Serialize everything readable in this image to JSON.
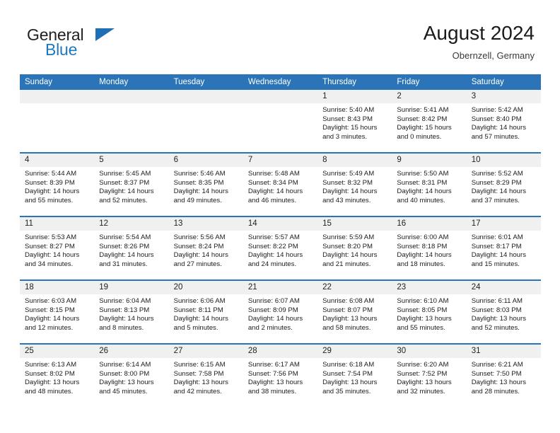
{
  "brand": {
    "name_top": "General",
    "name_bottom": "Blue",
    "accent_color": "#1f78bd",
    "dark_color": "#231f20"
  },
  "header": {
    "title": "August 2024",
    "subtitle": "Obernzell, Germany"
  },
  "theme": {
    "header_blue": "#2b74b8",
    "daynum_gray": "#f0f0f0",
    "text": "#1c1c1c"
  },
  "weekday_headers": [
    "Sunday",
    "Monday",
    "Tuesday",
    "Wednesday",
    "Thursday",
    "Friday",
    "Saturday"
  ],
  "labels": {
    "sunrise": "Sunrise:",
    "sunset": "Sunset:",
    "daylight": "Daylight:"
  },
  "weeks": [
    [
      {
        "day": "",
        "sunrise": "",
        "sunset": "",
        "daylight": ""
      },
      {
        "day": "",
        "sunrise": "",
        "sunset": "",
        "daylight": ""
      },
      {
        "day": "",
        "sunrise": "",
        "sunset": "",
        "daylight": ""
      },
      {
        "day": "",
        "sunrise": "",
        "sunset": "",
        "daylight": ""
      },
      {
        "day": "1",
        "sunrise": "Sunrise: 5:40 AM",
        "sunset": "Sunset: 8:43 PM",
        "daylight": "Daylight: 15 hours and 3 minutes."
      },
      {
        "day": "2",
        "sunrise": "Sunrise: 5:41 AM",
        "sunset": "Sunset: 8:42 PM",
        "daylight": "Daylight: 15 hours and 0 minutes."
      },
      {
        "day": "3",
        "sunrise": "Sunrise: 5:42 AM",
        "sunset": "Sunset: 8:40 PM",
        "daylight": "Daylight: 14 hours and 57 minutes."
      }
    ],
    [
      {
        "day": "4",
        "sunrise": "Sunrise: 5:44 AM",
        "sunset": "Sunset: 8:39 PM",
        "daylight": "Daylight: 14 hours and 55 minutes."
      },
      {
        "day": "5",
        "sunrise": "Sunrise: 5:45 AM",
        "sunset": "Sunset: 8:37 PM",
        "daylight": "Daylight: 14 hours and 52 minutes."
      },
      {
        "day": "6",
        "sunrise": "Sunrise: 5:46 AM",
        "sunset": "Sunset: 8:35 PM",
        "daylight": "Daylight: 14 hours and 49 minutes."
      },
      {
        "day": "7",
        "sunrise": "Sunrise: 5:48 AM",
        "sunset": "Sunset: 8:34 PM",
        "daylight": "Daylight: 14 hours and 46 minutes."
      },
      {
        "day": "8",
        "sunrise": "Sunrise: 5:49 AM",
        "sunset": "Sunset: 8:32 PM",
        "daylight": "Daylight: 14 hours and 43 minutes."
      },
      {
        "day": "9",
        "sunrise": "Sunrise: 5:50 AM",
        "sunset": "Sunset: 8:31 PM",
        "daylight": "Daylight: 14 hours and 40 minutes."
      },
      {
        "day": "10",
        "sunrise": "Sunrise: 5:52 AM",
        "sunset": "Sunset: 8:29 PM",
        "daylight": "Daylight: 14 hours and 37 minutes."
      }
    ],
    [
      {
        "day": "11",
        "sunrise": "Sunrise: 5:53 AM",
        "sunset": "Sunset: 8:27 PM",
        "daylight": "Daylight: 14 hours and 34 minutes."
      },
      {
        "day": "12",
        "sunrise": "Sunrise: 5:54 AM",
        "sunset": "Sunset: 8:26 PM",
        "daylight": "Daylight: 14 hours and 31 minutes."
      },
      {
        "day": "13",
        "sunrise": "Sunrise: 5:56 AM",
        "sunset": "Sunset: 8:24 PM",
        "daylight": "Daylight: 14 hours and 27 minutes."
      },
      {
        "day": "14",
        "sunrise": "Sunrise: 5:57 AM",
        "sunset": "Sunset: 8:22 PM",
        "daylight": "Daylight: 14 hours and 24 minutes."
      },
      {
        "day": "15",
        "sunrise": "Sunrise: 5:59 AM",
        "sunset": "Sunset: 8:20 PM",
        "daylight": "Daylight: 14 hours and 21 minutes."
      },
      {
        "day": "16",
        "sunrise": "Sunrise: 6:00 AM",
        "sunset": "Sunset: 8:18 PM",
        "daylight": "Daylight: 14 hours and 18 minutes."
      },
      {
        "day": "17",
        "sunrise": "Sunrise: 6:01 AM",
        "sunset": "Sunset: 8:17 PM",
        "daylight": "Daylight: 14 hours and 15 minutes."
      }
    ],
    [
      {
        "day": "18",
        "sunrise": "Sunrise: 6:03 AM",
        "sunset": "Sunset: 8:15 PM",
        "daylight": "Daylight: 14 hours and 12 minutes."
      },
      {
        "day": "19",
        "sunrise": "Sunrise: 6:04 AM",
        "sunset": "Sunset: 8:13 PM",
        "daylight": "Daylight: 14 hours and 8 minutes."
      },
      {
        "day": "20",
        "sunrise": "Sunrise: 6:06 AM",
        "sunset": "Sunset: 8:11 PM",
        "daylight": "Daylight: 14 hours and 5 minutes."
      },
      {
        "day": "21",
        "sunrise": "Sunrise: 6:07 AM",
        "sunset": "Sunset: 8:09 PM",
        "daylight": "Daylight: 14 hours and 2 minutes."
      },
      {
        "day": "22",
        "sunrise": "Sunrise: 6:08 AM",
        "sunset": "Sunset: 8:07 PM",
        "daylight": "Daylight: 13 hours and 58 minutes."
      },
      {
        "day": "23",
        "sunrise": "Sunrise: 6:10 AM",
        "sunset": "Sunset: 8:05 PM",
        "daylight": "Daylight: 13 hours and 55 minutes."
      },
      {
        "day": "24",
        "sunrise": "Sunrise: 6:11 AM",
        "sunset": "Sunset: 8:03 PM",
        "daylight": "Daylight: 13 hours and 52 minutes."
      }
    ],
    [
      {
        "day": "25",
        "sunrise": "Sunrise: 6:13 AM",
        "sunset": "Sunset: 8:02 PM",
        "daylight": "Daylight: 13 hours and 48 minutes."
      },
      {
        "day": "26",
        "sunrise": "Sunrise: 6:14 AM",
        "sunset": "Sunset: 8:00 PM",
        "daylight": "Daylight: 13 hours and 45 minutes."
      },
      {
        "day": "27",
        "sunrise": "Sunrise: 6:15 AM",
        "sunset": "Sunset: 7:58 PM",
        "daylight": "Daylight: 13 hours and 42 minutes."
      },
      {
        "day": "28",
        "sunrise": "Sunrise: 6:17 AM",
        "sunset": "Sunset: 7:56 PM",
        "daylight": "Daylight: 13 hours and 38 minutes."
      },
      {
        "day": "29",
        "sunrise": "Sunrise: 6:18 AM",
        "sunset": "Sunset: 7:54 PM",
        "daylight": "Daylight: 13 hours and 35 minutes."
      },
      {
        "day": "30",
        "sunrise": "Sunrise: 6:20 AM",
        "sunset": "Sunset: 7:52 PM",
        "daylight": "Daylight: 13 hours and 32 minutes."
      },
      {
        "day": "31",
        "sunrise": "Sunrise: 6:21 AM",
        "sunset": "Sunset: 7:50 PM",
        "daylight": "Daylight: 13 hours and 28 minutes."
      }
    ]
  ]
}
